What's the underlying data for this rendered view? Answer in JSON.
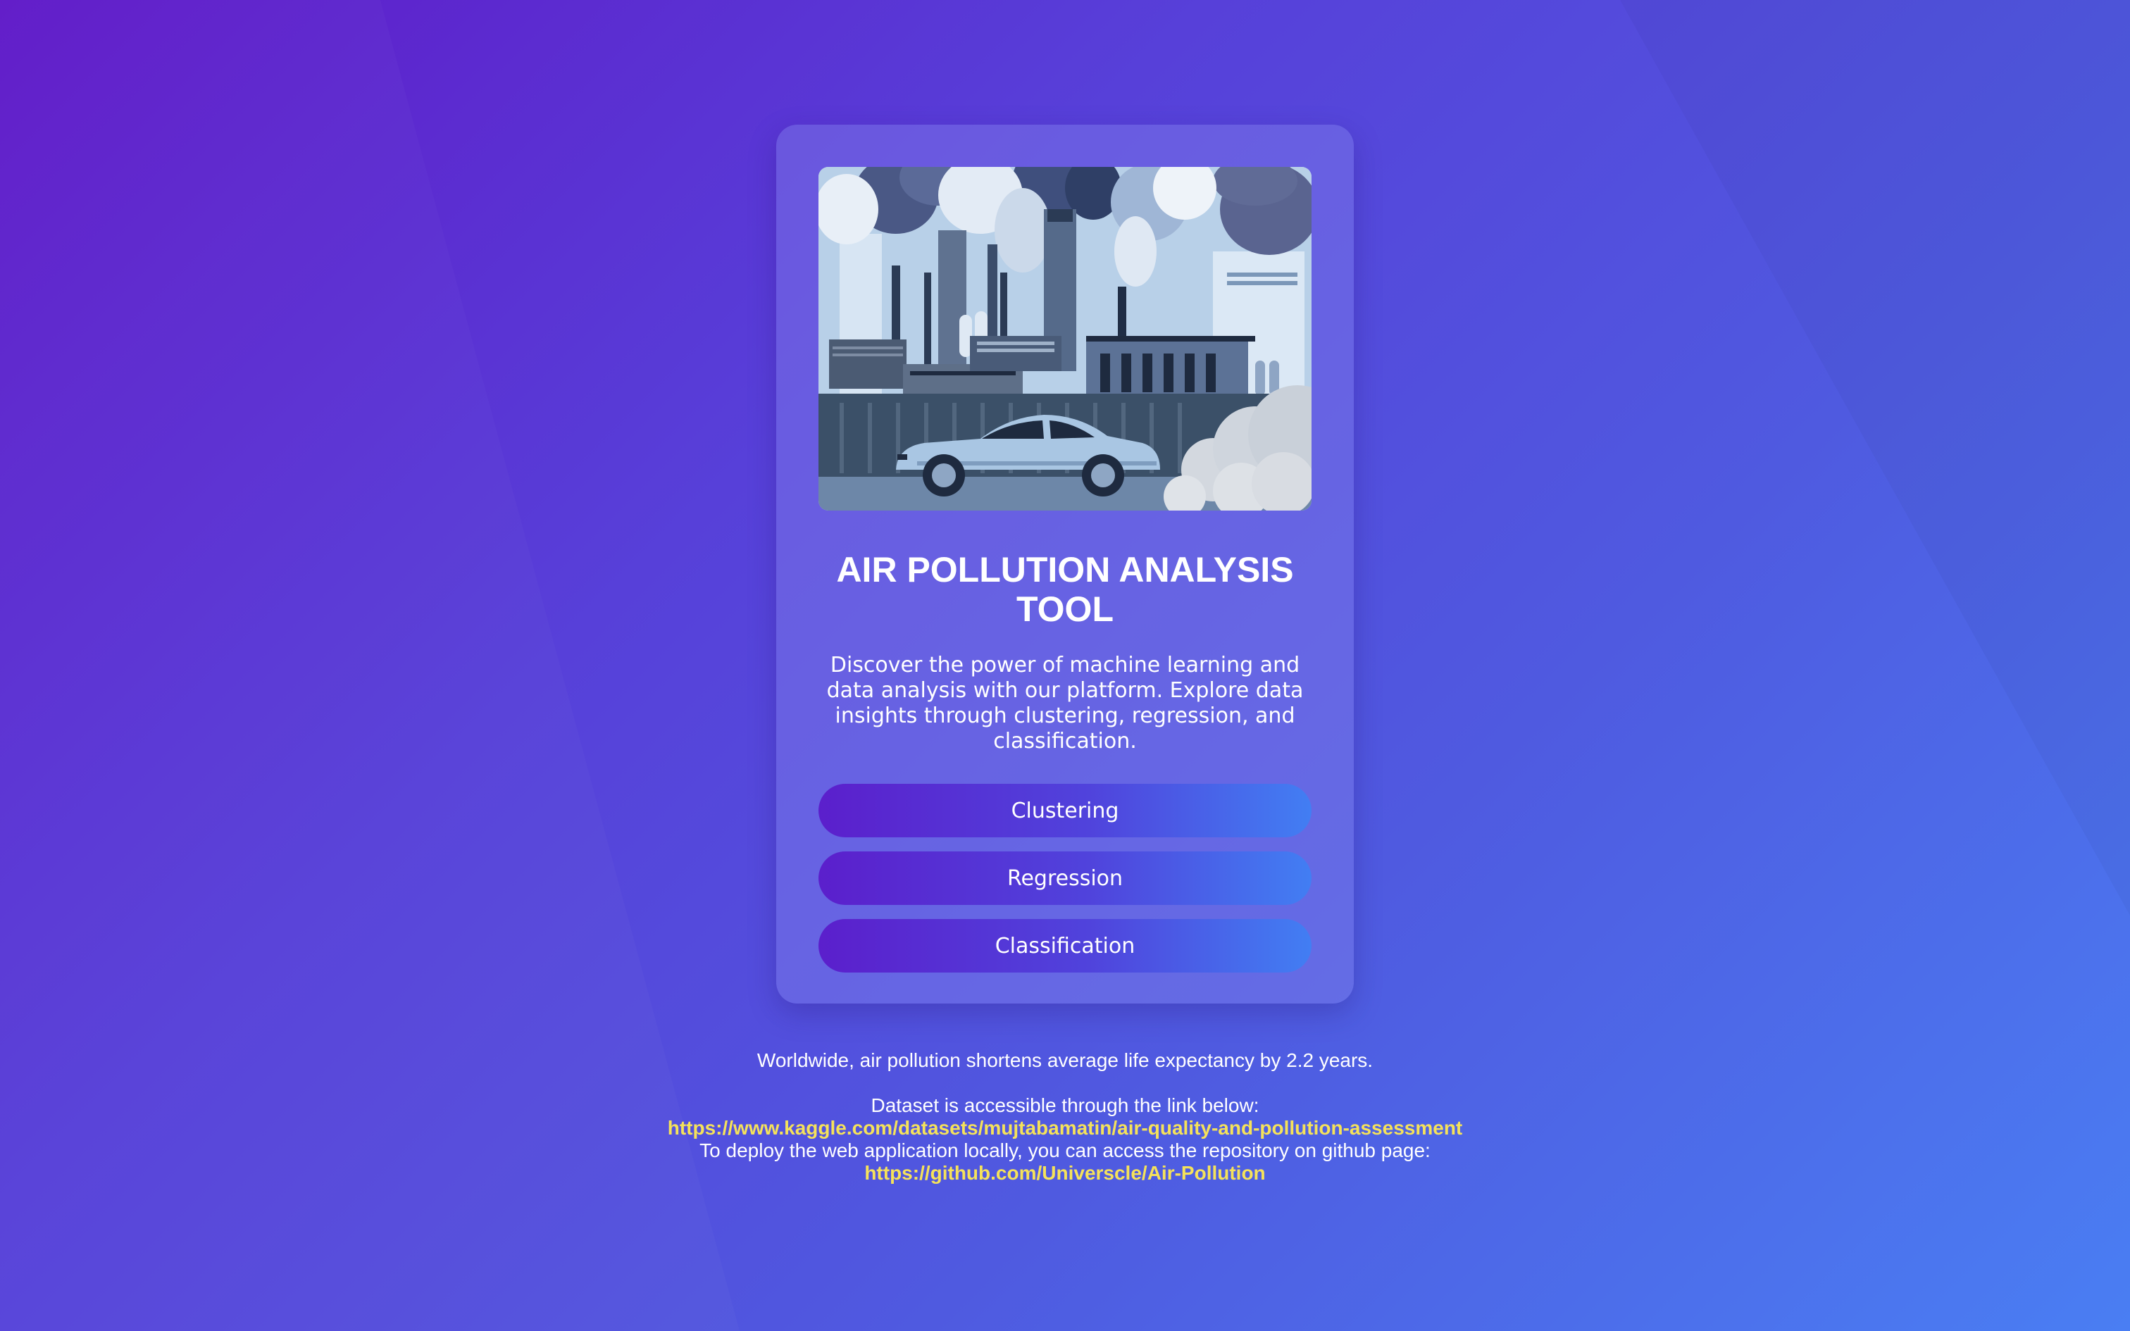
{
  "card": {
    "title": "AIR POLLUTION ANALYSIS TOOL",
    "description": "Discover the power of machine learning and data analysis with our platform. Explore data insights through clustering, regression, and classification.",
    "buttons": [
      {
        "label": "Clustering"
      },
      {
        "label": "Regression"
      },
      {
        "label": "Classification"
      }
    ],
    "image_subject": "illustration-factories-smoke-car"
  },
  "footer": {
    "fact": "Worldwide, air pollution shortens average life expectancy by 2.2 years.",
    "dataset_intro": "Dataset is accessible through the link below:",
    "dataset_link": "https://www.kaggle.com/datasets/mujtabamatin/air-quality-and-pollution-assessment",
    "repo_intro": "To deploy the web application locally, you can access the repository on github page:",
    "repo_link": "https://github.com/Universcle/Air-Pollution"
  },
  "colors": {
    "background_start": "#6019c8",
    "background_end": "#4a7ef3",
    "button_start": "#5b1fcc",
    "button_end": "#427ef3",
    "link": "#f5e25a"
  }
}
